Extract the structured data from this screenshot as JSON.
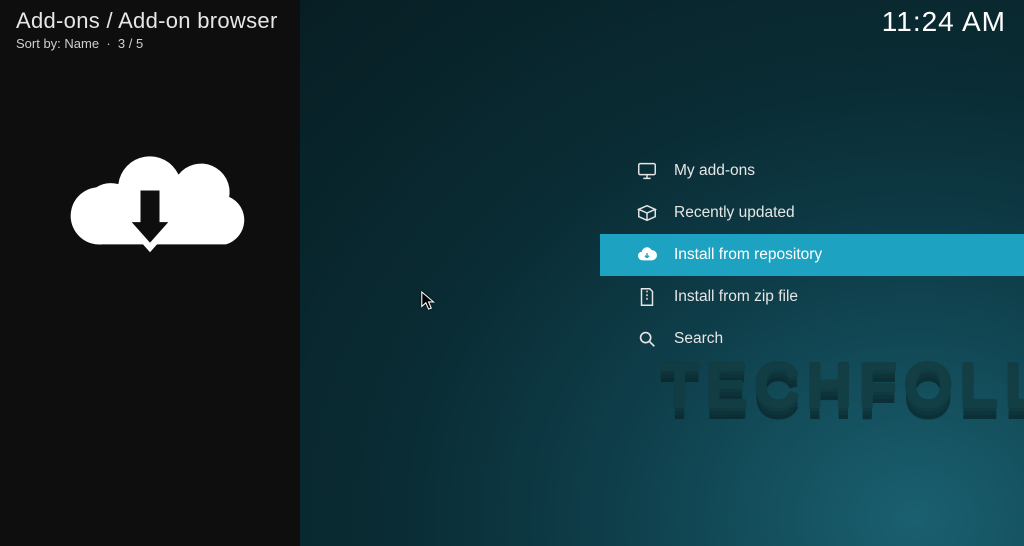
{
  "header": {
    "breadcrumb": "Add-ons / Add-on browser",
    "sort_label": "Sort by: Name",
    "separator": "·",
    "position": "3 / 5",
    "clock": "11:24 AM"
  },
  "menu": {
    "items": [
      {
        "label": "My add-ons"
      },
      {
        "label": "Recently updated"
      },
      {
        "label": "Install from repository"
      },
      {
        "label": "Install from zip file"
      },
      {
        "label": "Search"
      }
    ],
    "selected_index": 2
  },
  "watermark": "TECHFOLLOWS"
}
